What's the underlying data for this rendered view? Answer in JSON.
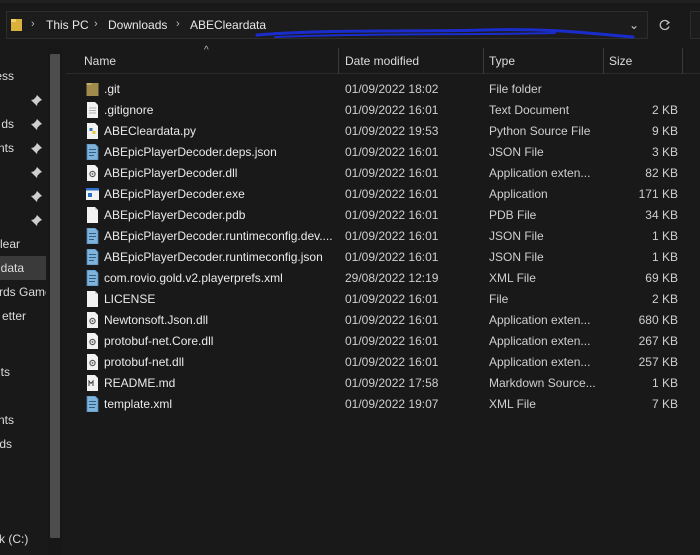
{
  "breadcrumb": {
    "items": [
      "This PC",
      "Downloads",
      "ABECleardata"
    ],
    "separator": "›"
  },
  "nav": {
    "items": [
      {
        "label": "ess",
        "pinned": false
      },
      {
        "label": "ds",
        "pinned": true
      },
      {
        "label": "nts",
        "pinned": true
      },
      {
        "label": "",
        "pinned": true
      },
      {
        "label": "",
        "pinned": true
      },
      {
        "label": "",
        "pinned": true
      },
      {
        "label": "",
        "pinned": true
      },
      {
        "label": "lear",
        "pinned": false
      },
      {
        "label": "data",
        "pinned": false,
        "selected": true
      },
      {
        "label": "rds Game",
        "pinned": false
      },
      {
        "label": "etter",
        "pinned": false
      },
      {
        "label": "",
        "pinned": false
      },
      {
        "label": "ts",
        "pinned": false
      },
      {
        "label": "",
        "pinned": false
      },
      {
        "label": "nts",
        "pinned": false
      },
      {
        "label": "ds",
        "pinned": false
      },
      {
        "label": "k (C:)",
        "pinned": false
      }
    ]
  },
  "columns": {
    "name": "Name",
    "date": "Date modified",
    "type": "Type",
    "size": "Size"
  },
  "files": [
    {
      "name": ".git",
      "date": "01/09/2022 18:02",
      "type": "File folder",
      "size": "",
      "icon": "folder-icon"
    },
    {
      "name": ".gitignore",
      "date": "01/09/2022 16:01",
      "type": "Text Document",
      "size": "2 KB",
      "icon": "text-file-icon"
    },
    {
      "name": "ABECleardata.py",
      "date": "01/09/2022 19:53",
      "type": "Python Source File",
      "size": "9 KB",
      "icon": "python-file-icon"
    },
    {
      "name": "ABEpicPlayerDecoder.deps.json",
      "date": "01/09/2022 16:01",
      "type": "JSON File",
      "size": "3 KB",
      "icon": "json-file-icon"
    },
    {
      "name": "ABEpicPlayerDecoder.dll",
      "date": "01/09/2022 16:01",
      "type": "Application exten...",
      "size": "82 KB",
      "icon": "dll-file-icon"
    },
    {
      "name": "ABEpicPlayerDecoder.exe",
      "date": "01/09/2022 16:01",
      "type": "Application",
      "size": "171 KB",
      "icon": "exe-file-icon"
    },
    {
      "name": "ABEpicPlayerDecoder.pdb",
      "date": "01/09/2022 16:01",
      "type": "PDB File",
      "size": "34 KB",
      "icon": "blank-file-icon"
    },
    {
      "name": "ABEpicPlayerDecoder.runtimeconfig.dev....",
      "date": "01/09/2022 16:01",
      "type": "JSON File",
      "size": "1 KB",
      "icon": "json-file-icon"
    },
    {
      "name": "ABEpicPlayerDecoder.runtimeconfig.json",
      "date": "01/09/2022 16:01",
      "type": "JSON File",
      "size": "1 KB",
      "icon": "json-file-icon"
    },
    {
      "name": "com.rovio.gold.v2.playerprefs.xml",
      "date": "29/08/2022 12:19",
      "type": "XML File",
      "size": "69 KB",
      "icon": "xml-file-icon"
    },
    {
      "name": "LICENSE",
      "date": "01/09/2022 16:01",
      "type": "File",
      "size": "2 KB",
      "icon": "blank-file-icon"
    },
    {
      "name": "Newtonsoft.Json.dll",
      "date": "01/09/2022 16:01",
      "type": "Application exten...",
      "size": "680 KB",
      "icon": "dll-file-icon"
    },
    {
      "name": "protobuf-net.Core.dll",
      "date": "01/09/2022 16:01",
      "type": "Application exten...",
      "size": "267 KB",
      "icon": "dll-file-icon"
    },
    {
      "name": "protobuf-net.dll",
      "date": "01/09/2022 16:01",
      "type": "Application exten...",
      "size": "257 KB",
      "icon": "dll-file-icon"
    },
    {
      "name": "README.md",
      "date": "01/09/2022 17:58",
      "type": "Markdown Source...",
      "size": "1 KB",
      "icon": "markdown-file-icon"
    },
    {
      "name": "template.xml",
      "date": "01/09/2022 19:07",
      "type": "XML File",
      "size": "7 KB",
      "icon": "xml-file-icon"
    }
  ],
  "colors": {
    "background": "#191919",
    "selected": "#3a3a3a",
    "folder": "#c9a227",
    "scribble": "#1a2dcc"
  }
}
